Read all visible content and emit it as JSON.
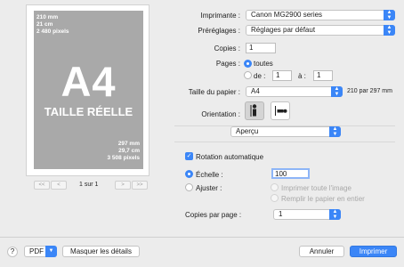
{
  "preview": {
    "size_top": [
      "210 mm",
      "21 cm",
      "2 480 pixels"
    ],
    "big": "A4",
    "sub": "TAILLE RÉELLE",
    "size_bottom": [
      "297 mm",
      "29,7 cm",
      "3 508 pixels"
    ],
    "page_indicator": "1 sur 1",
    "nav": {
      "first": "<<",
      "prev": "<",
      "next": ">",
      "last": ">>"
    }
  },
  "settings": {
    "printer_label": "Imprimante :",
    "printer_value": "Canon MG2900 series",
    "presets_label": "Préréglages :",
    "presets_value": "Réglages par défaut",
    "copies_label": "Copies :",
    "copies_value": "1",
    "pages_label": "Pages :",
    "pages_all": "toutes",
    "pages_from": "de :",
    "pages_from_value": "1",
    "pages_to": "à :",
    "pages_to_value": "1",
    "paper_label": "Taille du papier :",
    "paper_value": "A4",
    "paper_dims": "210 par 297 mm",
    "orientation_label": "Orientation :",
    "section_value": "Aperçu",
    "auto_rotate": "Rotation automatique",
    "scale_label": "Échelle :",
    "scale_value": "100",
    "fit_label": "Ajuster :",
    "fit_print_all": "Imprimer toute l'image",
    "fit_fill": "Remplir le papier en entier",
    "copies_per_page_label": "Copies par page :",
    "copies_per_page_value": "1"
  },
  "footer": {
    "help": "?",
    "pdf": "PDF",
    "details": "Masquer les détails",
    "cancel": "Annuler",
    "print": "Imprimer"
  },
  "colors": {
    "accent": "#3b86f7",
    "background": "#ececec"
  }
}
